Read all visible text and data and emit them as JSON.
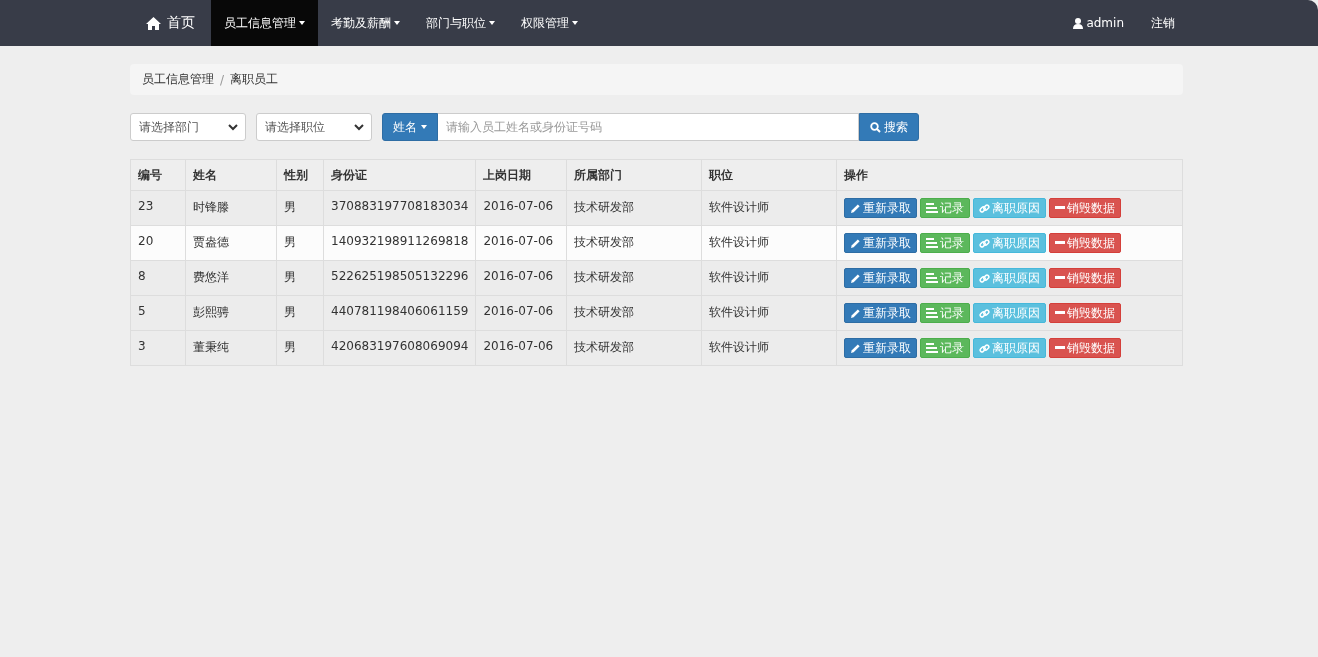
{
  "navbar": {
    "home": "首页",
    "menus": [
      {
        "label": "员工信息管理",
        "selected": true
      },
      {
        "label": "考勤及薪酬",
        "selected": false
      },
      {
        "label": "部门与职位",
        "selected": false
      },
      {
        "label": "权限管理",
        "selected": false
      }
    ],
    "user": "admin",
    "logout": "注销"
  },
  "breadcrumb": {
    "items": [
      "员工信息管理",
      "离职员工"
    ],
    "separator": "/"
  },
  "filters": {
    "department": "请选择部门",
    "position": "请选择职位",
    "search_by": "姓名",
    "search_placeholder": "请输入员工姓名或身份证号码",
    "search_button": "搜索"
  },
  "table": {
    "columns": [
      "编号",
      "姓名",
      "性别",
      "身份证",
      "上岗日期",
      "所属部门",
      "职位",
      "操作"
    ],
    "rows": [
      {
        "cells": [
          "23",
          "时锋滕",
          "男",
          "370883197708183034",
          "2016-07-06",
          "技术研发部",
          "软件设计师"
        ],
        "hovered": false,
        "actions": [
          {
            "kind": "rehire",
            "label": "重新录取"
          },
          {
            "kind": "record",
            "label": "记录"
          },
          {
            "kind": "reason",
            "label": "离职原因"
          },
          {
            "kind": "destroy",
            "label": "销毁数据"
          }
        ]
      },
      {
        "cells": [
          "20",
          "贾盎德",
          "男",
          "140932198911269818",
          "2016-07-06",
          "技术研发部",
          "软件设计师"
        ],
        "hovered": true,
        "actions": [
          {
            "kind": "rehire",
            "label": "重新录取"
          },
          {
            "kind": "record",
            "label": "记录"
          },
          {
            "kind": "reason",
            "label": "离职原因"
          },
          {
            "kind": "destroy",
            "label": "销毁数据"
          }
        ]
      },
      {
        "cells": [
          "8",
          "费悠洋",
          "男",
          "522625198505132296",
          "2016-07-06",
          "技术研发部",
          "软件设计师"
        ],
        "hovered": false,
        "actions": [
          {
            "kind": "rehire",
            "label": "重新录取"
          },
          {
            "kind": "record",
            "label": "记录"
          },
          {
            "kind": "reason",
            "label": "离职原因"
          },
          {
            "kind": "destroy",
            "label": "销毁数据"
          }
        ]
      },
      {
        "cells": [
          "5",
          "彭熙骋",
          "男",
          "440781198406061159",
          "2016-07-06",
          "技术研发部",
          "软件设计师"
        ],
        "hovered": false,
        "actions": [
          {
            "kind": "rehire",
            "label": "重新录取"
          },
          {
            "kind": "record",
            "label": "记录"
          },
          {
            "kind": "reason",
            "label": "离职原因"
          },
          {
            "kind": "destroy",
            "label": "销毁数据"
          }
        ]
      },
      {
        "cells": [
          "3",
          "董秉纯",
          "男",
          "420683197608069094",
          "2016-07-06",
          "技术研发部",
          "软件设计师"
        ],
        "hovered": false,
        "actions": [
          {
            "kind": "rehire",
            "label": "重新录取"
          },
          {
            "kind": "record",
            "label": "记录"
          },
          {
            "kind": "reason",
            "label": "离职原因"
          },
          {
            "kind": "destroy",
            "label": "销毁数据"
          }
        ]
      }
    ]
  }
}
